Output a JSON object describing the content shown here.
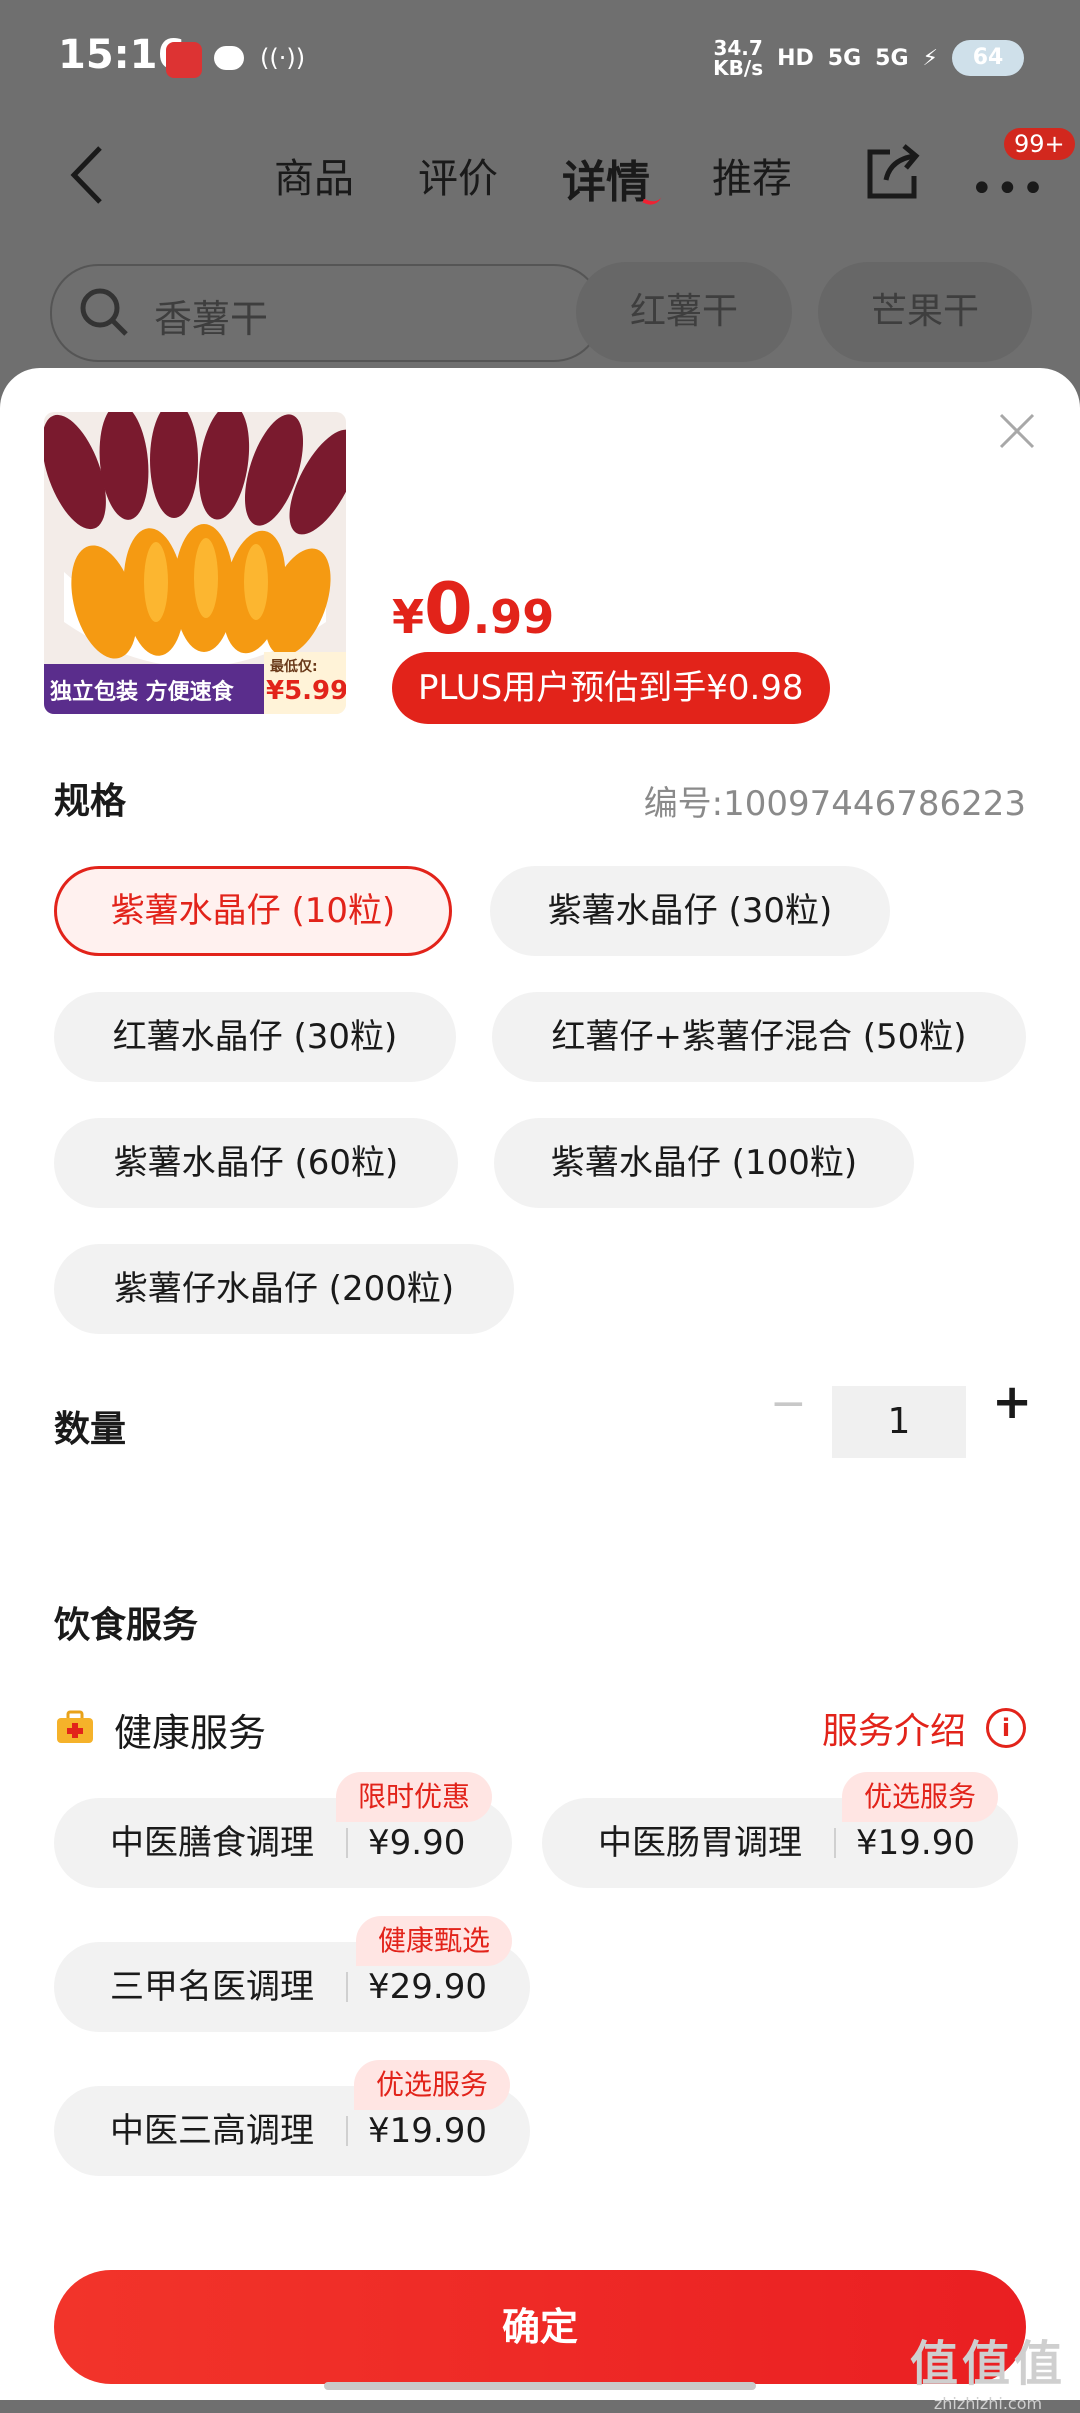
{
  "status_bar": {
    "time": "15:16",
    "speed_top": "34.7",
    "speed_bottom": "KB/s",
    "hd": "HD",
    "net1": "5G",
    "net2": "5G",
    "battery": "64"
  },
  "nav": {
    "tabs": [
      "商品",
      "评价",
      "详情",
      "推荐"
    ],
    "active_tab": "详情",
    "badge": "99+"
  },
  "search": {
    "text": "香薯干",
    "chips": [
      "红薯干",
      "芒果干"
    ]
  },
  "product": {
    "thumb_banner": "独立包装 方便速食",
    "thumb_low_label": "最低仅:",
    "thumb_low_price": "¥5.99",
    "price_currency": "¥",
    "price_int": "0",
    "price_dec": ".99",
    "plus_text": "PLUS用户预估到手¥0.98"
  },
  "spec": {
    "title": "规格",
    "sku_id": "编号:10097446786223",
    "options": [
      "紫薯水晶仔 (10粒)",
      "紫薯水晶仔 (30粒)",
      "红薯水晶仔 (30粒)",
      "红薯仔+紫薯仔混合 (50粒)",
      "紫薯水晶仔 (60粒)",
      "紫薯水晶仔 (100粒)",
      "紫薯仔水晶仔 (200粒)"
    ],
    "selected_index": 0
  },
  "quantity": {
    "title": "数量",
    "value": "1",
    "minus": "−",
    "plus": "+"
  },
  "diet": {
    "title": "饮食服务",
    "health_label": "健康服务",
    "intro_label": "服务介绍",
    "services": [
      {
        "name": "中医膳食调理",
        "price": "¥9.90",
        "tag": "限时优惠"
      },
      {
        "name": "中医肠胃调理",
        "price": "¥19.90",
        "tag": "优选服务"
      },
      {
        "name": "三甲名医调理",
        "price": "¥29.90",
        "tag": "健康甄选"
      },
      {
        "name": "中医三高调理",
        "price": "¥19.90",
        "tag": "优选服务"
      }
    ]
  },
  "confirm_label": "确定",
  "watermark": {
    "big": "值值值",
    "small": "zhizhizhi.com"
  },
  "colors": {
    "accent": "#e2231a",
    "overlay": "#6f6f6f",
    "chip": "#f2f2f2"
  }
}
